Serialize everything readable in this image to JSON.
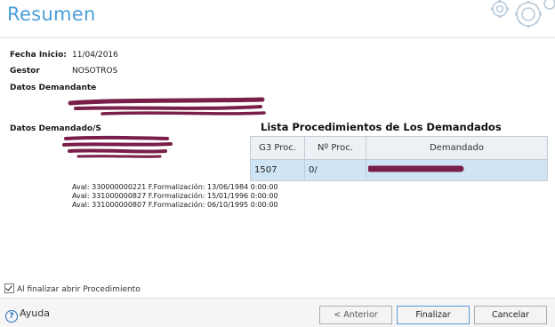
{
  "title": "Resumen",
  "fields": {
    "fecha_inicio_label": "Fecha Inicio:",
    "fecha_inicio_value": "11/04/2016",
    "gestor_label": "Gestor",
    "gestor_value": "NOSOTROS",
    "datos_demandante_label": "Datos Demandante",
    "datos_demandado_label": "Datos Demandado/S"
  },
  "list": {
    "title": "Lista Procedimientos de Los Demandados",
    "columns": [
      "G3 Proc.",
      "Nº Proc.",
      "Demandado"
    ],
    "rows": [
      {
        "g3": "1507",
        "num": "0/",
        "demandado": ""
      }
    ]
  },
  "avales": [
    "Aval: 330000000221 F.Formalización: 13/06/1984 0:00:00",
    "Aval: 331000000827 F.Formalización: 15/01/1996 0:00:00",
    "Aval: 331000000807 F.Formalización: 06/10/1995 0:00:00"
  ],
  "checkbox": {
    "label": "Al finalizar abrir Procedimiento",
    "checked": true
  },
  "footer": {
    "help_label": "Ayuda",
    "anterior_label": "< Anterior",
    "finalizar_label": "Finalizar",
    "cancelar_label": "Cancelar"
  },
  "colors": {
    "title": "#4a9ed9",
    "redaction": "#7a1f4a",
    "row_selected": "#cfe5f5"
  },
  "icons": [
    "gears-icon",
    "help-icon",
    "checkmark-icon"
  ]
}
